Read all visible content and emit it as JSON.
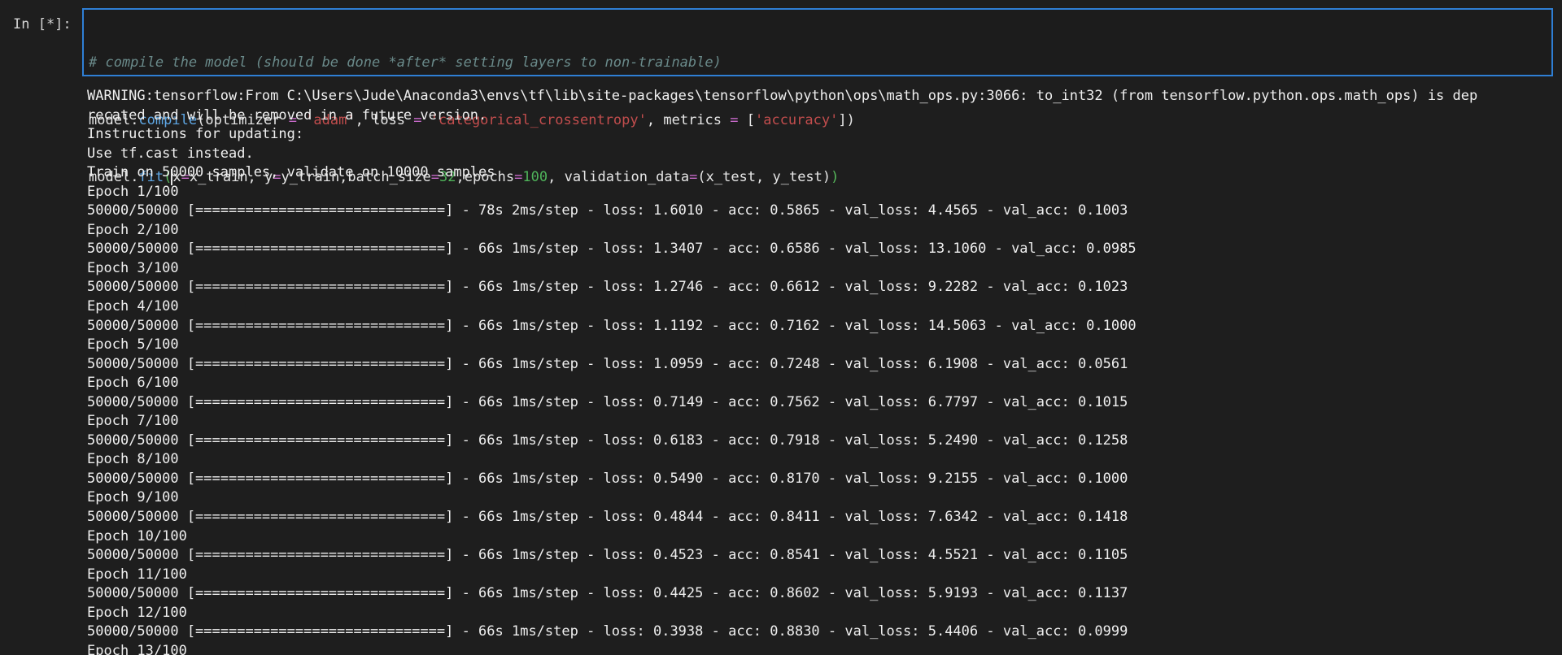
{
  "prompt": "In [*]:",
  "code": {
    "comment": "# compile the model (should be done *after* setting layers to non-trainable)",
    "line2": {
      "obj": "model",
      "dot": ".",
      "method": "compile",
      "open": "(",
      "p1": "optimizer",
      "eq1": " = ",
      "v1": "'adam'",
      "sep1": ", ",
      "p2": "loss",
      "eq2": " = ",
      "v2": "'categorical_crossentropy'",
      "sep2": ", ",
      "p3": "metrics",
      "eq3": " = ",
      "lb": "[",
      "v3": "'accuracy'",
      "close": "])"
    },
    "line3": {
      "obj": "model",
      "dot": ".",
      "method": "fit",
      "open": "(",
      "p1": "x",
      "eq1": "=",
      "v1": "x_train, ",
      "p2": "y",
      "eq2": "=",
      "v2": "y_train,batch_size",
      "eq3": "=",
      "n1": "32",
      "s1": ",epochs",
      "eq4": "=",
      "n2": "100",
      "s2": ", validation_data",
      "eq5": "=",
      "s3": "(x_test, y_test)",
      "close": ")"
    }
  },
  "output": [
    "WARNING:tensorflow:From C:\\Users\\Jude\\Anaconda3\\envs\\tf\\lib\\site-packages\\tensorflow\\python\\ops\\math_ops.py:3066: to_int32 (from tensorflow.python.ops.math_ops) is dep",
    "recated and will be removed in a future version.",
    "Instructions for updating:",
    "Use tf.cast instead.",
    "Train on 50000 samples, validate on 10000 samples",
    "Epoch 1/100",
    "50000/50000 [==============================] - 78s 2ms/step - loss: 1.6010 - acc: 0.5865 - val_loss: 4.4565 - val_acc: 0.1003",
    "Epoch 2/100",
    "50000/50000 [==============================] - 66s 1ms/step - loss: 1.3407 - acc: 0.6586 - val_loss: 13.1060 - val_acc: 0.0985",
    "Epoch 3/100",
    "50000/50000 [==============================] - 66s 1ms/step - loss: 1.2746 - acc: 0.6612 - val_loss: 9.2282 - val_acc: 0.1023",
    "Epoch 4/100",
    "50000/50000 [==============================] - 66s 1ms/step - loss: 1.1192 - acc: 0.7162 - val_loss: 14.5063 - val_acc: 0.1000",
    "Epoch 5/100",
    "50000/50000 [==============================] - 66s 1ms/step - loss: 1.0959 - acc: 0.7248 - val_loss: 6.1908 - val_acc: 0.0561",
    "Epoch 6/100",
    "50000/50000 [==============================] - 66s 1ms/step - loss: 0.7149 - acc: 0.7562 - val_loss: 6.7797 - val_acc: 0.1015",
    "Epoch 7/100",
    "50000/50000 [==============================] - 66s 1ms/step - loss: 0.6183 - acc: 0.7918 - val_loss: 5.2490 - val_acc: 0.1258",
    "Epoch 8/100",
    "50000/50000 [==============================] - 66s 1ms/step - loss: 0.5490 - acc: 0.8170 - val_loss: 9.2155 - val_acc: 0.1000",
    "Epoch 9/100",
    "50000/50000 [==============================] - 66s 1ms/step - loss: 0.4844 - acc: 0.8411 - val_loss: 7.6342 - val_acc: 0.1418",
    "Epoch 10/100",
    "50000/50000 [==============================] - 66s 1ms/step - loss: 0.4523 - acc: 0.8541 - val_loss: 4.5521 - val_acc: 0.1105",
    "Epoch 11/100",
    "50000/50000 [==============================] - 66s 1ms/step - loss: 0.4425 - acc: 0.8602 - val_loss: 5.9193 - val_acc: 0.1137",
    "Epoch 12/100",
    "50000/50000 [==============================] - 66s 1ms/step - loss: 0.3938 - acc: 0.8830 - val_loss: 5.4406 - val_acc: 0.0999",
    "Epoch 13/100"
  ]
}
